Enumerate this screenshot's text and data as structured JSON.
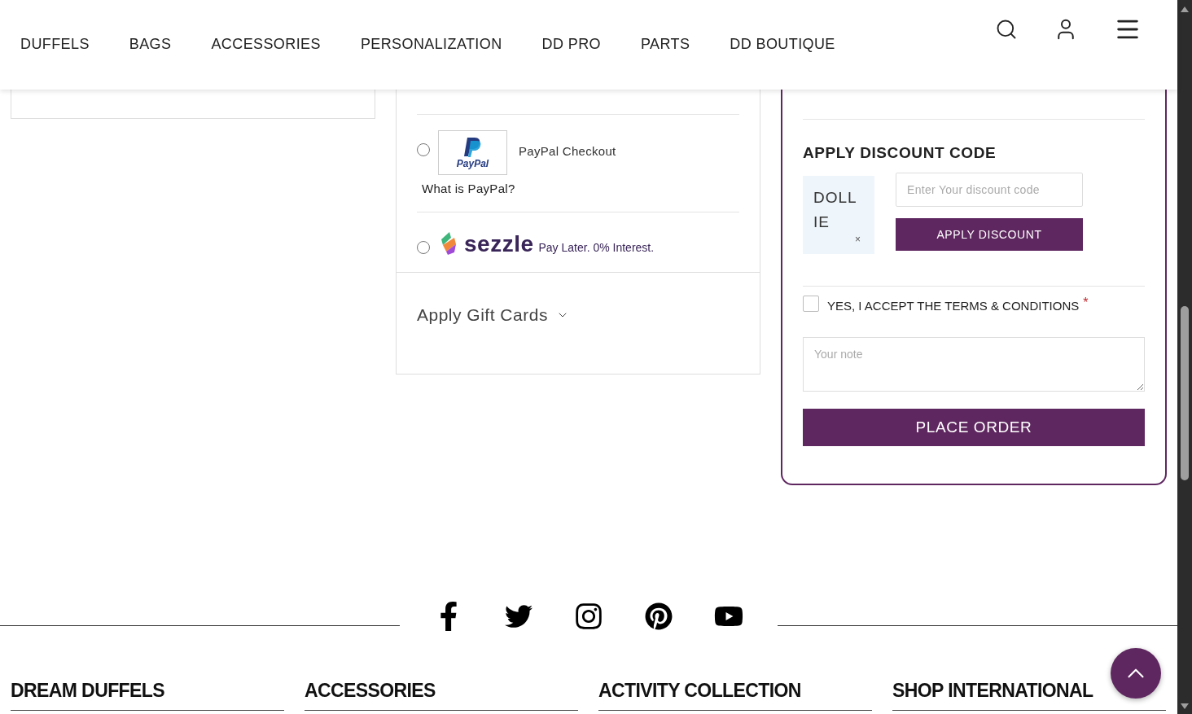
{
  "nav": {
    "items": [
      "DUFFELS",
      "BAGS",
      "ACCESSORIES",
      "PERSONALIZATION",
      "DD PRO",
      "PARTS",
      "DD BOUTIQUE"
    ]
  },
  "payment_methods": [
    {
      "kind": "paypal",
      "selected": false,
      "logo_text": "PayPal",
      "label": "PayPal Checkout",
      "link": "What is PayPal?"
    },
    {
      "kind": "sezzle",
      "selected": false,
      "logo_text": "sezzle",
      "tagline": "Pay Later. 0% Interest."
    }
  ],
  "gift_cards": {
    "label": "Apply Gift Cards",
    "expanded": false
  },
  "discount": {
    "title": "APPLY DISCOUNT CODE",
    "applied_code": "DOLLIE",
    "remove": "×",
    "placeholder": "Enter Your discount code",
    "button": "APPLY DISCOUNT"
  },
  "terms": {
    "label": "YES, I ACCEPT THE TERMS & CONDITIONS",
    "required_mark": "*",
    "checked": false
  },
  "note": {
    "placeholder": "Your note"
  },
  "place_order": "PLACE ORDER",
  "footer": {
    "columns": [
      "DREAM DUFFELS",
      "ACCESSORIES",
      "ACTIVITY COLLECTION",
      "SHOP INTERNATIONAL"
    ]
  }
}
